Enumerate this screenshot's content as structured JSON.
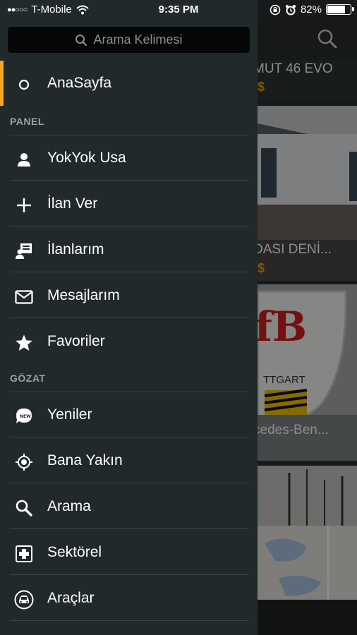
{
  "status_bar": {
    "signal_dots": "●●○○○",
    "carrier": "T-Mobile",
    "time": "9:35 PM",
    "battery": "82%",
    "battery_level": 0.82
  },
  "drawer": {
    "search_placeholder": "Arama Kelimesi",
    "home_label": "AnaSayfa",
    "panel_title": "PANEL",
    "panel_items": [
      {
        "label": "YokYok Usa",
        "icon": "person-icon"
      },
      {
        "label": "İlan Ver",
        "icon": "plus-icon"
      },
      {
        "label": "İlanlarım",
        "icon": "listings-icon"
      },
      {
        "label": "Mesajlarım",
        "icon": "envelope-icon"
      },
      {
        "label": "Favoriler",
        "icon": "star-icon"
      }
    ],
    "browse_title": "GÖZAT",
    "browse_items": [
      {
        "label": "Yeniler",
        "icon": "new-badge-icon"
      },
      {
        "label": "Bana Yakın",
        "icon": "location-target-icon"
      },
      {
        "label": "Arama",
        "icon": "search-icon"
      },
      {
        "label": "Sektörel",
        "icon": "medical-cross-icon"
      },
      {
        "label": "Araçlar",
        "icon": "car-icon"
      }
    ]
  },
  "background_listings": [
    {
      "title": "MUT 46 EVO",
      "price": "$"
    },
    {
      "title": "DASI DENİ...",
      "price": "$"
    },
    {
      "title": "cedes-Ben...",
      "price": ""
    },
    {
      "title": "",
      "price": ""
    }
  ],
  "colors": {
    "accent": "#f5a623",
    "drawer_bg": "#22292b",
    "price": "#f0a000"
  }
}
